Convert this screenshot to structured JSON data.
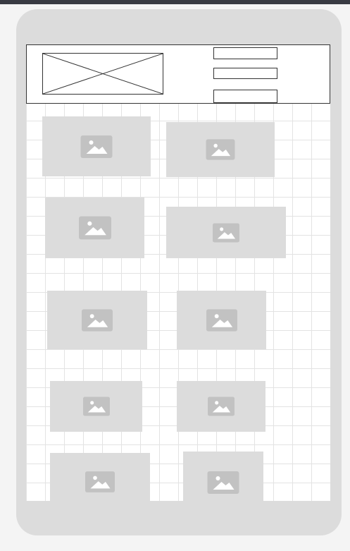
{
  "screen": {
    "title": "",
    "header": {
      "logo": "image-placeholder-icon",
      "nav_items": [
        "",
        "",
        ""
      ]
    },
    "cards": [
      {
        "icon": "image-icon"
      },
      {
        "icon": "image-icon"
      },
      {
        "icon": "image-icon"
      },
      {
        "icon": "image-icon"
      },
      {
        "icon": "image-icon"
      },
      {
        "icon": "image-icon"
      },
      {
        "icon": "image-icon"
      },
      {
        "icon": "image-icon"
      },
      {
        "icon": "image-icon"
      },
      {
        "icon": "image-icon"
      }
    ]
  },
  "colors": {
    "device_frame": "#dcdcdc",
    "placeholder_fill": "#dcdcdc",
    "icon_fill": "#c2c2c2",
    "grid_line": "#e3e3e3",
    "outline": "#333333",
    "top_strip": "#383a42"
  }
}
